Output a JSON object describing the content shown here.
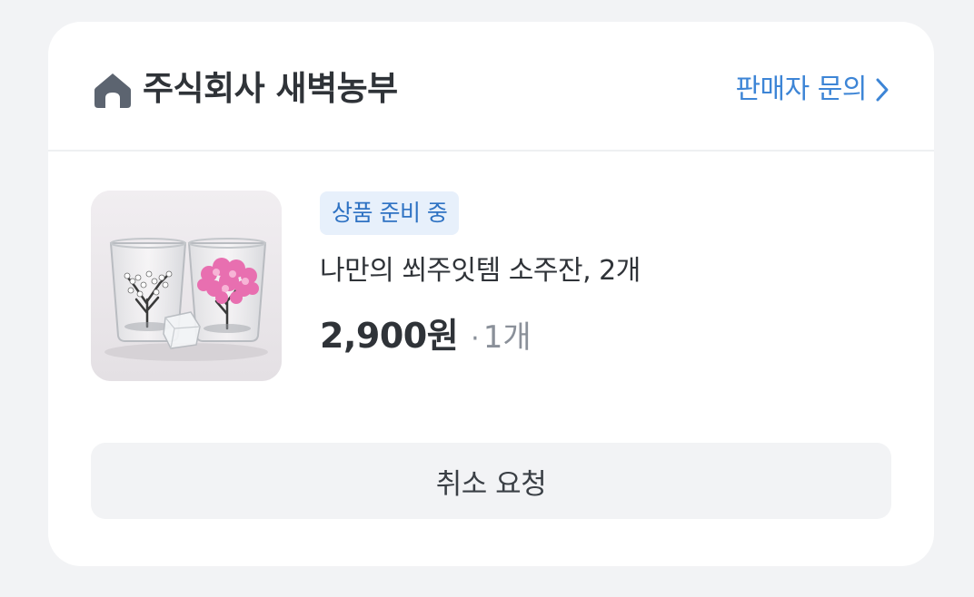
{
  "seller": {
    "name": "주식회사 새벽농부",
    "store_icon": "store-house-icon",
    "inquiry_label": "판매자 문의",
    "inquiry_icon": "chevron-right-icon"
  },
  "order_item": {
    "status_badge": "상품 준비 중",
    "product_name": "나만의 쐬주잇템 소주잔, 2개",
    "price": "2,900원",
    "separator": "·",
    "quantity": "1개",
    "image_icon": "shot-glasses-image"
  },
  "actions": {
    "cancel_label": "취소 요청"
  },
  "colors": {
    "accent": "#3d85d6",
    "badge_bg": "#e7f0fb",
    "badge_text": "#2e72c3",
    "text_primary": "#2f3338",
    "text_muted": "#8a9099",
    "button_bg": "#f2f3f5",
    "page_bg": "#f2f3f5"
  }
}
